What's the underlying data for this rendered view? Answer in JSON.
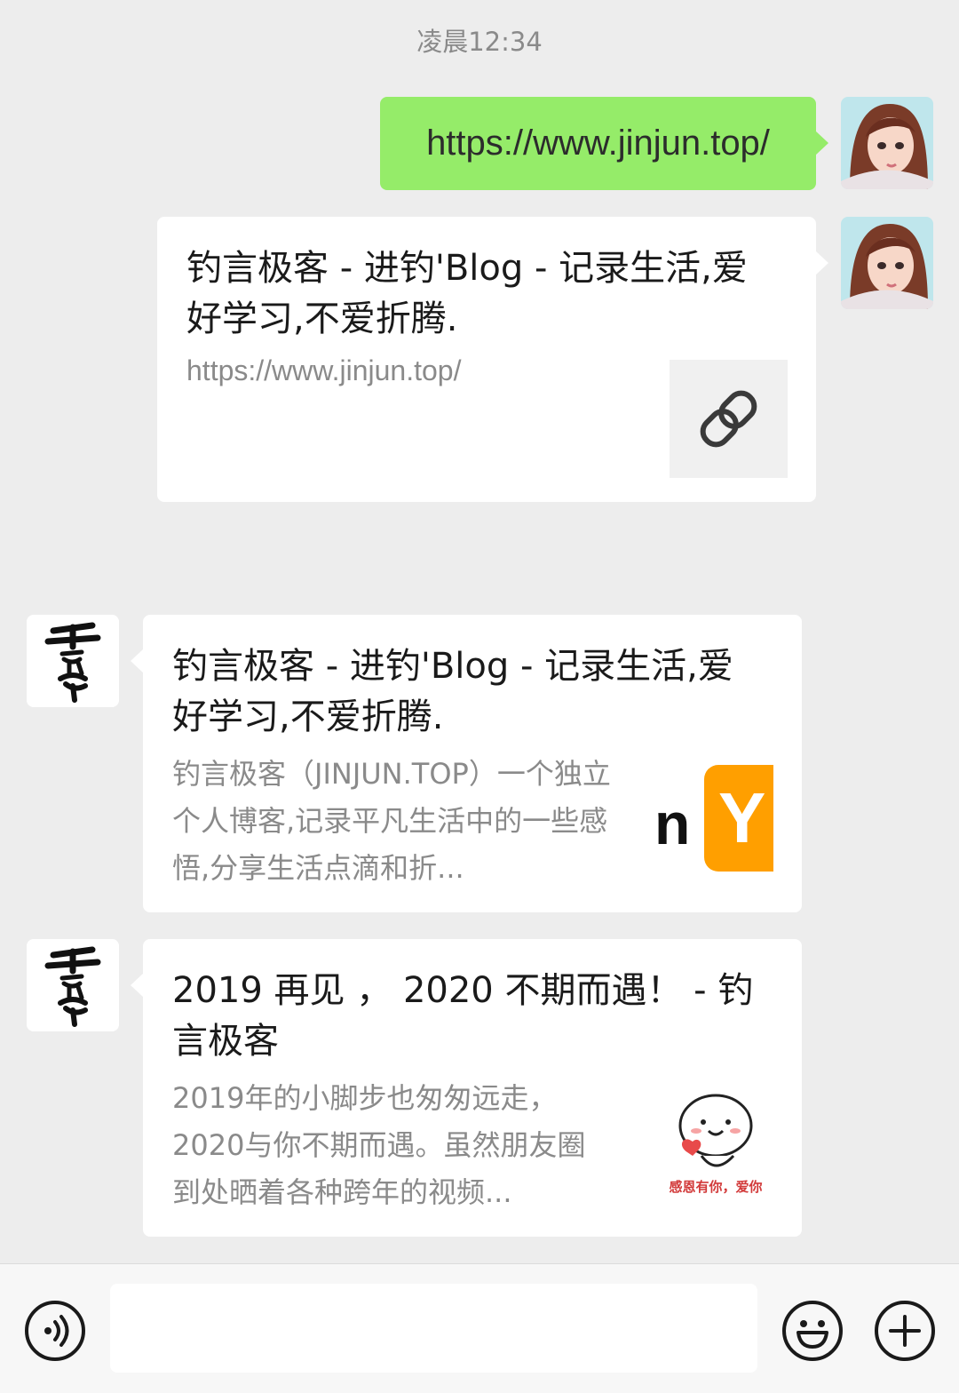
{
  "timestamp": "凌晨12:34",
  "messages": {
    "sent_text": "https://www.jinjun.top/",
    "sent_card": {
      "title": "钓言极客 - 进钓'Blog - 记录生活,爱好学习,不爱折腾.",
      "url": "https://www.jinjun.top/",
      "thumb_icon": "link-icon"
    },
    "recv_card_1": {
      "title": "钓言极客 - 进钓'Blog - 记录生活,爱好学习,不爱折腾.",
      "description": "钓言极客（JINJUN.TOP）一个独立个人博客,记录平凡生活中的一些感悟,分享生活点滴和折...",
      "thumb_text_n": "n",
      "thumb_text_y": "Y"
    },
    "recv_card_2": {
      "title": "2019 再见 ， 2020 不期而遇！ - 钓言极客",
      "description": "2019年的小脚步也匆匆远走，2020与你不期而遇。虽然朋友圈到处晒着各种跨年的视频...",
      "thumb_caption": "感恩有你，爱你"
    }
  },
  "contact_avatar_text": "千能秀",
  "bottom_bar": {
    "voice_icon": "voice-icon",
    "emoji_icon": "emoji-icon",
    "plus_icon": "plus-icon"
  },
  "colors": {
    "background": "#ededed",
    "sent_bubble": "#95ec69",
    "card": "#ffffff",
    "secondary_text": "#8a8a8a",
    "thumb_orange": "#ff9f00"
  }
}
